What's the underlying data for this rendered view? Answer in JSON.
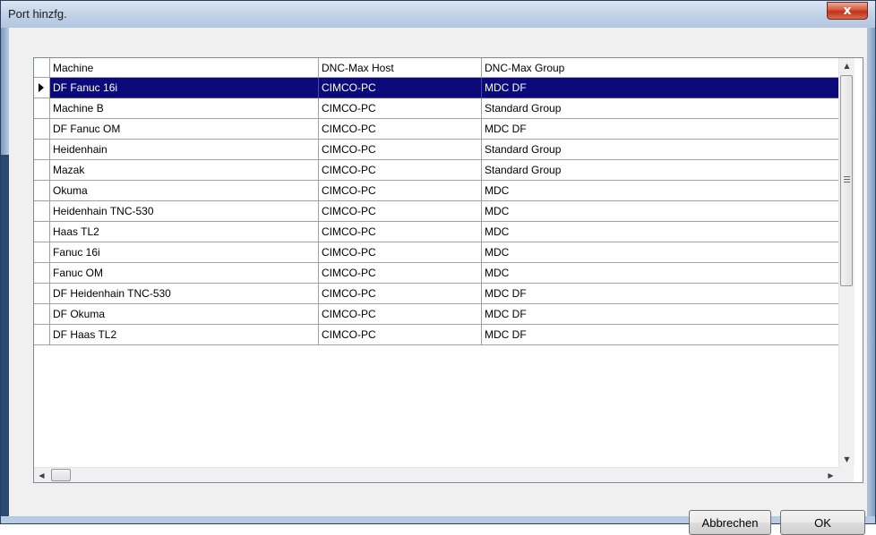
{
  "window": {
    "title": "Port hinzfg.",
    "close_label": "x"
  },
  "table": {
    "columns": [
      "Machine",
      "DNC-Max Host",
      "DNC-Max Group"
    ],
    "selected_index": 0,
    "rows": [
      {
        "machine": "DF Fanuc 16i",
        "host": "CIMCO-PC",
        "group": "MDC DF"
      },
      {
        "machine": "Machine B",
        "host": "CIMCO-PC",
        "group": "Standard Group"
      },
      {
        "machine": "DF Fanuc OM",
        "host": "CIMCO-PC",
        "group": "MDC DF"
      },
      {
        "machine": "Heidenhain",
        "host": "CIMCO-PC",
        "group": "Standard Group"
      },
      {
        "machine": "Mazak",
        "host": "CIMCO-PC",
        "group": "Standard Group"
      },
      {
        "machine": "Okuma",
        "host": "CIMCO-PC",
        "group": "MDC"
      },
      {
        "machine": "Heidenhain TNC-530",
        "host": "CIMCO-PC",
        "group": "MDC"
      },
      {
        "machine": "Haas TL2",
        "host": "CIMCO-PC",
        "group": "MDC"
      },
      {
        "machine": "Fanuc 16i",
        "host": "CIMCO-PC",
        "group": "MDC"
      },
      {
        "machine": "Fanuc OM",
        "host": "CIMCO-PC",
        "group": "MDC"
      },
      {
        "machine": "DF Heidenhain TNC-530",
        "host": "CIMCO-PC",
        "group": "MDC DF"
      },
      {
        "machine": "DF Okuma",
        "host": "CIMCO-PC",
        "group": "MDC DF"
      },
      {
        "machine": "DF Haas TL2",
        "host": "CIMCO-PC",
        "group": "MDC DF"
      }
    ]
  },
  "buttons": {
    "cancel_label": "Abbrechen",
    "ok_label": "OK"
  },
  "colors": {
    "selection": "#0a0a7a",
    "title_bar": "#c4d4e8",
    "close_button": "#c2321a"
  }
}
